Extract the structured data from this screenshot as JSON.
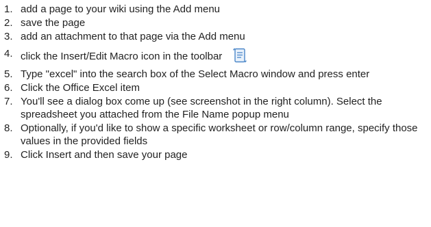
{
  "steps": [
    {
      "num": "1.",
      "text": "add a page to your wiki using the Add menu"
    },
    {
      "num": "2.",
      "text": "save the page"
    },
    {
      "num": "3.",
      "text": "add an attachment to that page via the Add menu"
    },
    {
      "num": "4.",
      "text": "click the Insert/Edit Macro icon in the toolbar",
      "icon": "macro-scroll-icon"
    },
    {
      "num": "5.",
      "text": "Type \"excel\" into the search box of the Select Macro window and press enter"
    },
    {
      "num": "6.",
      "text": "Click the Office Excel item"
    },
    {
      "num": "7.",
      "text": "You'll see a dialog box come up (see screenshot in the right column). Select the spreadsheet you attached from the File Name popup menu"
    },
    {
      "num": "8.",
      "text": "Optionally, if you'd like to show a specific worksheet or row/column range, specify those values in the provided fields"
    },
    {
      "num": "9.",
      "text": "Click Insert and then save your page"
    }
  ],
  "colors": {
    "text": "#222222",
    "icon_stroke": "#4a86c8",
    "icon_fill": "#e8f1fb"
  }
}
